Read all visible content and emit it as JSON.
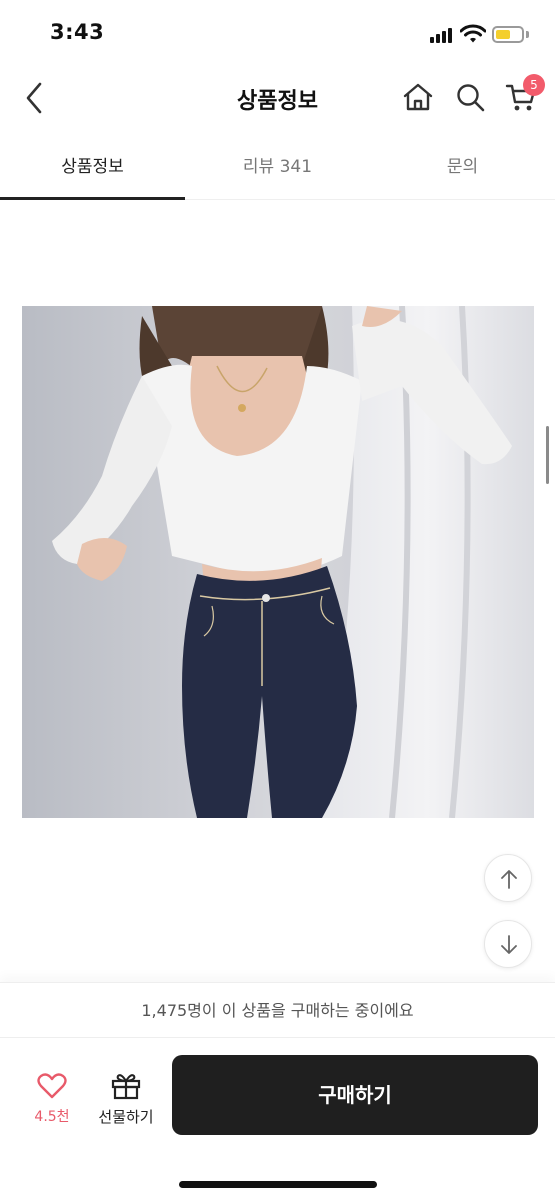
{
  "status_bar": {
    "time": "3:43"
  },
  "header": {
    "title": "상품정보",
    "cart_count": "5"
  },
  "tabs": [
    {
      "label": "상품정보",
      "active": true
    },
    {
      "label": "리뷰 341",
      "active": false
    },
    {
      "label": "문의",
      "active": false
    }
  ],
  "purchase_banner": "1,475명이 이 상품을 구매하는 중이에요",
  "action_bar": {
    "like_count": "4.5천",
    "gift_label": "선물하기",
    "buy_label": "구매하기"
  },
  "colors": {
    "accent_pink": "#e85a6a",
    "badge": "#f25b6b",
    "buy_button": "#1f1f1f"
  }
}
